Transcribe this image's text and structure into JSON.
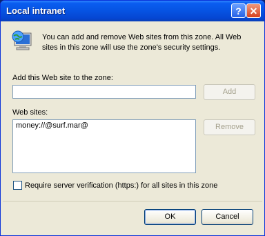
{
  "window": {
    "title": "Local intranet"
  },
  "titlebar": {
    "help_glyph": "?",
    "close_glyph": "✕"
  },
  "intro": {
    "text": "You can add and remove Web sites from this zone. All Web sites in this zone will use the zone's security settings."
  },
  "add_section": {
    "label": "Add this Web site to the zone:",
    "value": "",
    "add_button": "Add"
  },
  "sites_section": {
    "label": "Web sites:",
    "sites": [
      "money://@surf.mar@"
    ],
    "remove_button": "Remove"
  },
  "verification": {
    "label": "Require server verification (https:) for all sites in this zone",
    "checked": false
  },
  "footer": {
    "ok_button": "OK",
    "cancel_button": "Cancel"
  },
  "icons": {
    "intro": "globe-computer-icon"
  }
}
